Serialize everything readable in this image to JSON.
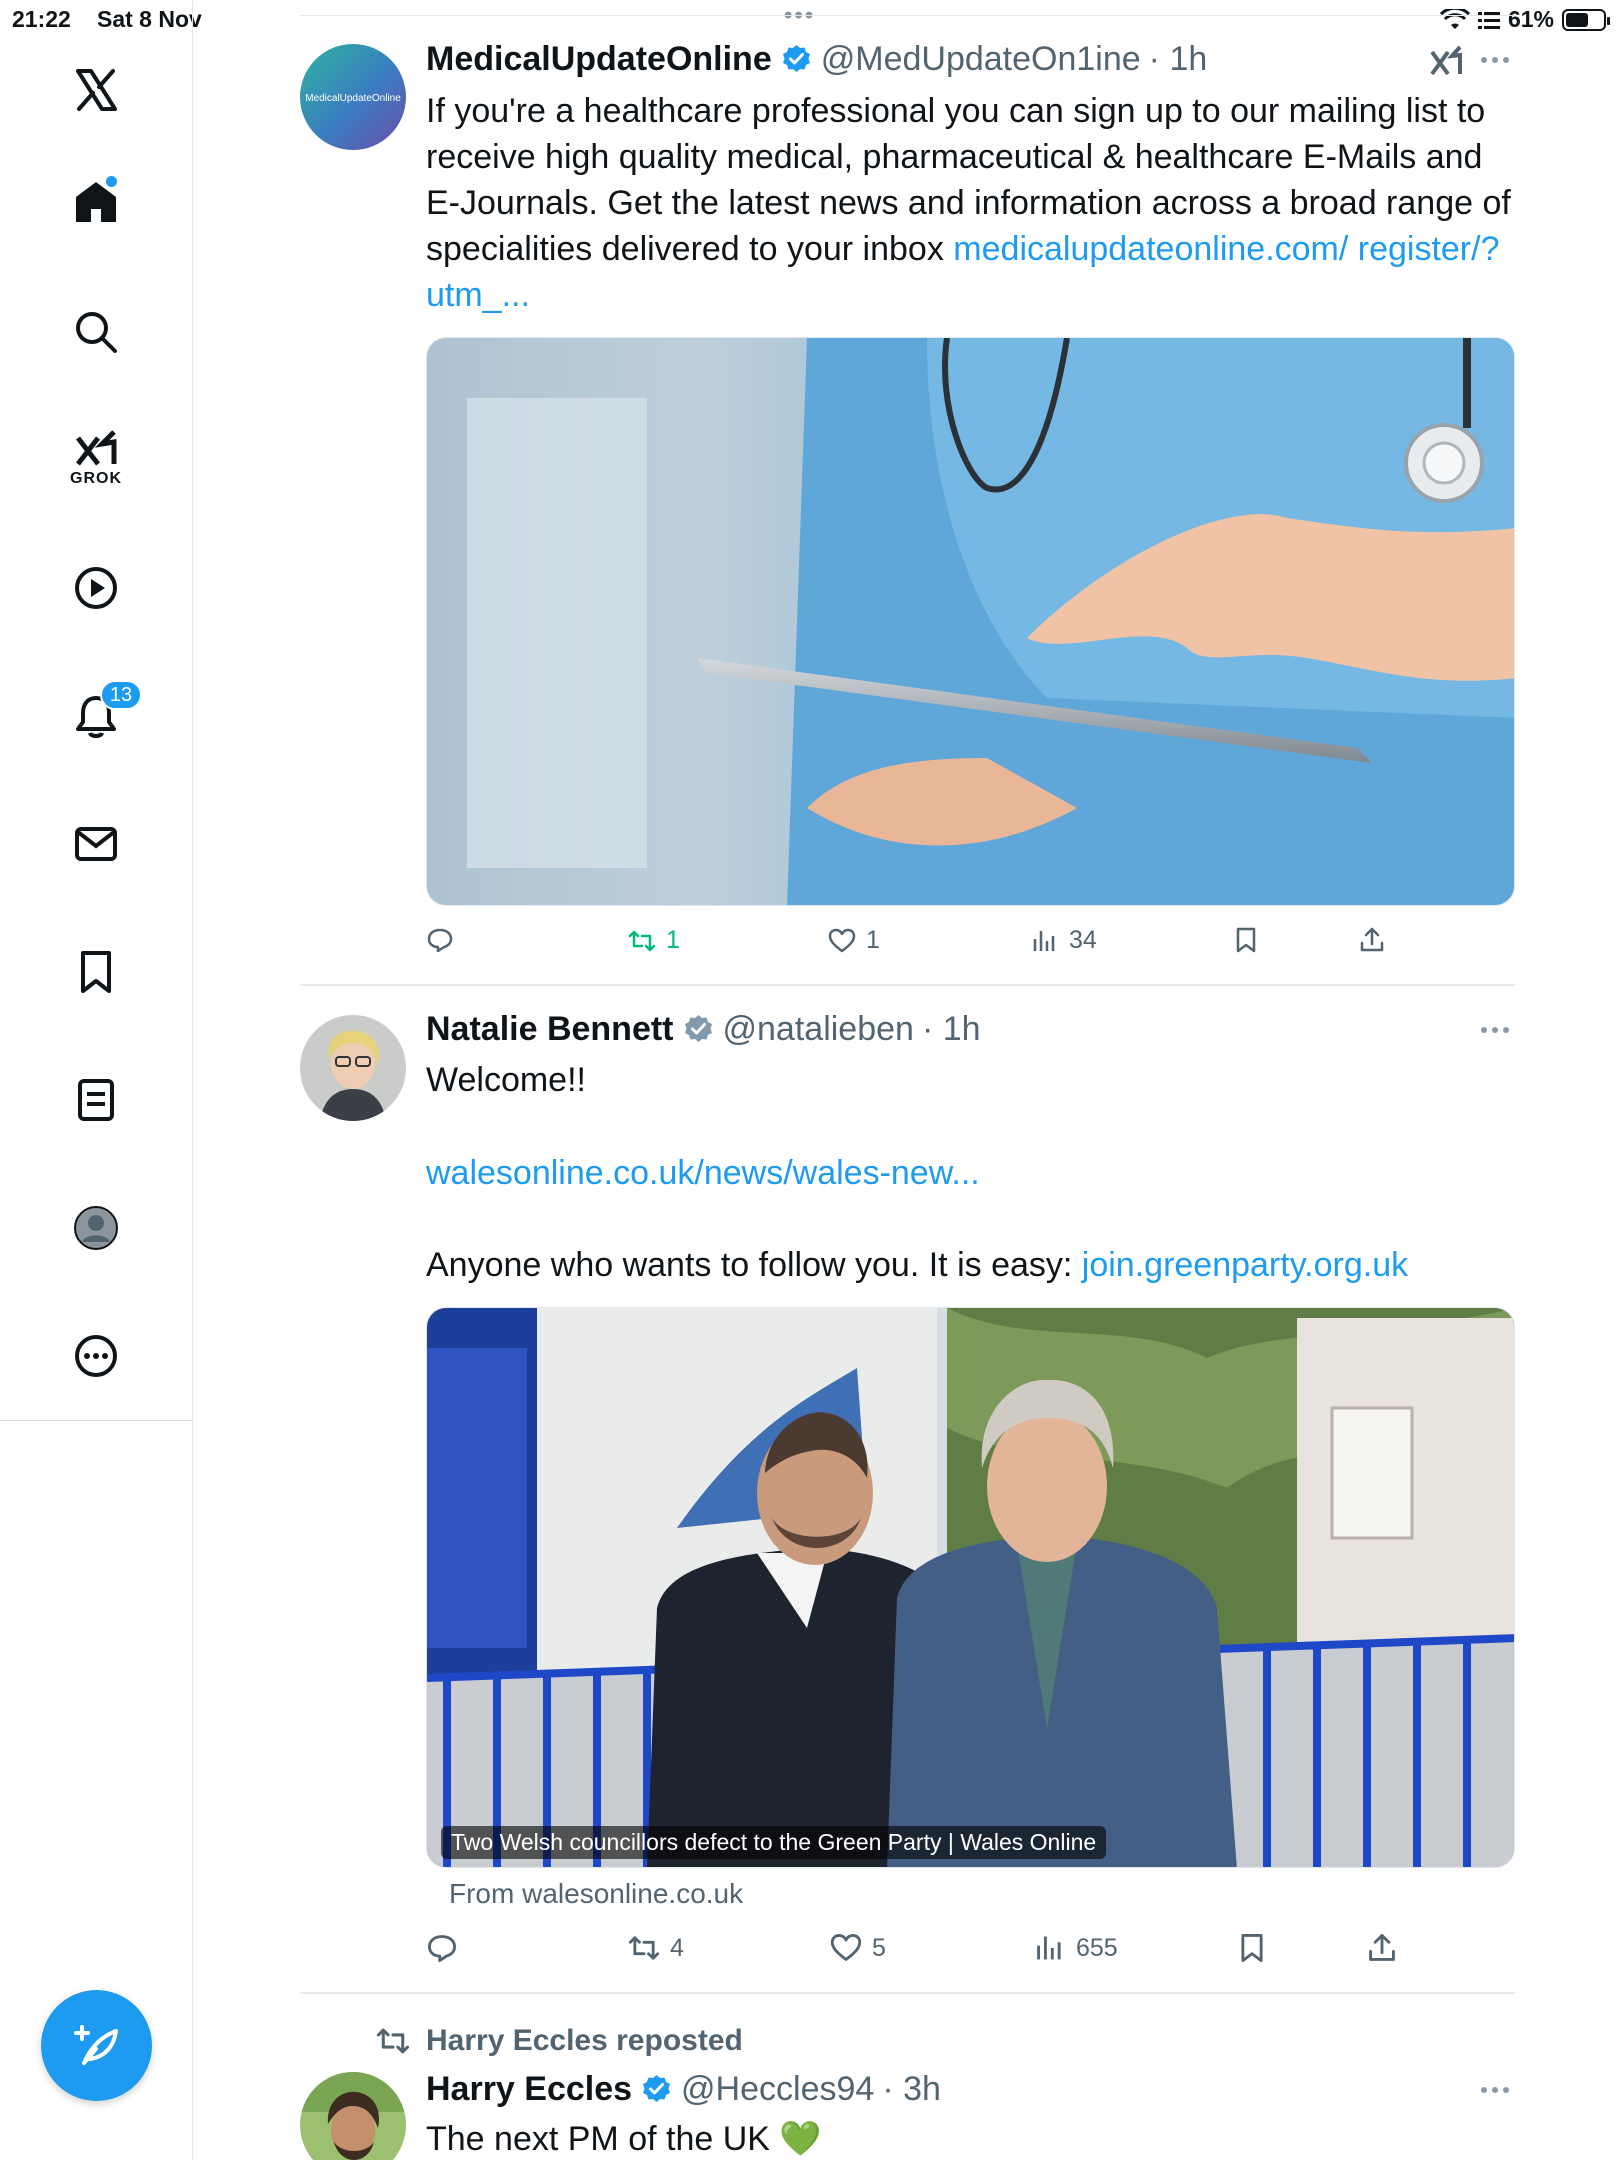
{
  "status_bar": {
    "time": "21:22",
    "date": "Sat 8 Nov",
    "battery": "61%",
    "battery_level": 0.61
  },
  "sidebar": {
    "items": [
      {
        "name": "X",
        "icon": "x-logo-icon"
      },
      {
        "name": "Home",
        "icon": "home-icon",
        "unread": true
      },
      {
        "name": "Search",
        "icon": "search-icon"
      },
      {
        "name": "Grok",
        "icon": "grok-icon",
        "label": "GROK"
      },
      {
        "name": "Videos",
        "icon": "play-icon"
      },
      {
        "name": "Notifications",
        "icon": "bell-icon",
        "badge": "13"
      },
      {
        "name": "Messages",
        "icon": "mail-icon"
      },
      {
        "name": "Bookmarks",
        "icon": "bookmark-icon"
      },
      {
        "name": "Lists",
        "icon": "list-icon"
      },
      {
        "name": "Profile",
        "icon": "profile-icon"
      },
      {
        "name": "More",
        "icon": "more-icon"
      }
    ],
    "compose_icon": "compose-feather-icon"
  },
  "colors": {
    "accent": "#1d9bf0",
    "repost_green": "#00ba7c",
    "text": "#0f1419",
    "muted": "#536471"
  },
  "tweets": [
    {
      "name": "MedicalUpdateOnline",
      "handle": "@MedUpdateOn1ine",
      "time": "· 1h",
      "verified": true,
      "avatar_text": "MedicalUpdateOnline",
      "text_plain": "If you're a healthcare professional you can sign up to our mailing list to receive high quality medical, pharmaceutical & healthcare E-Mails and E-Journals. Get the latest news and information across a broad range of specialities delivered to your inbox ",
      "text_link": "medicalupdateonline.com/ register/?utm_...",
      "actions": {
        "replies": "",
        "reposts": "1",
        "likes": "1",
        "views": "34"
      },
      "reposted_by_me": true
    },
    {
      "name": "Natalie Bennett",
      "handle": "@natalieben",
      "time": "· 1h",
      "verified": true,
      "line1": "Welcome!!",
      "link1": "walesonline.co.uk/news/wales-new...",
      "line2": "Anyone who wants to follow you. It is easy: ",
      "link2": "join.greenparty.org.uk",
      "card_title": "Two Welsh councillors defect to the Green Party | Wales Online",
      "card_source": "From walesonline.co.uk",
      "actions": {
        "replies": "",
        "reposts": "4",
        "likes": "5",
        "views": "655"
      }
    },
    {
      "repost_by": "Harry Eccles reposted",
      "name": "Harry Eccles",
      "handle": "@Heccles94",
      "time": "· 3h",
      "verified": true,
      "text": "The next PM of the UK 💚"
    }
  ]
}
